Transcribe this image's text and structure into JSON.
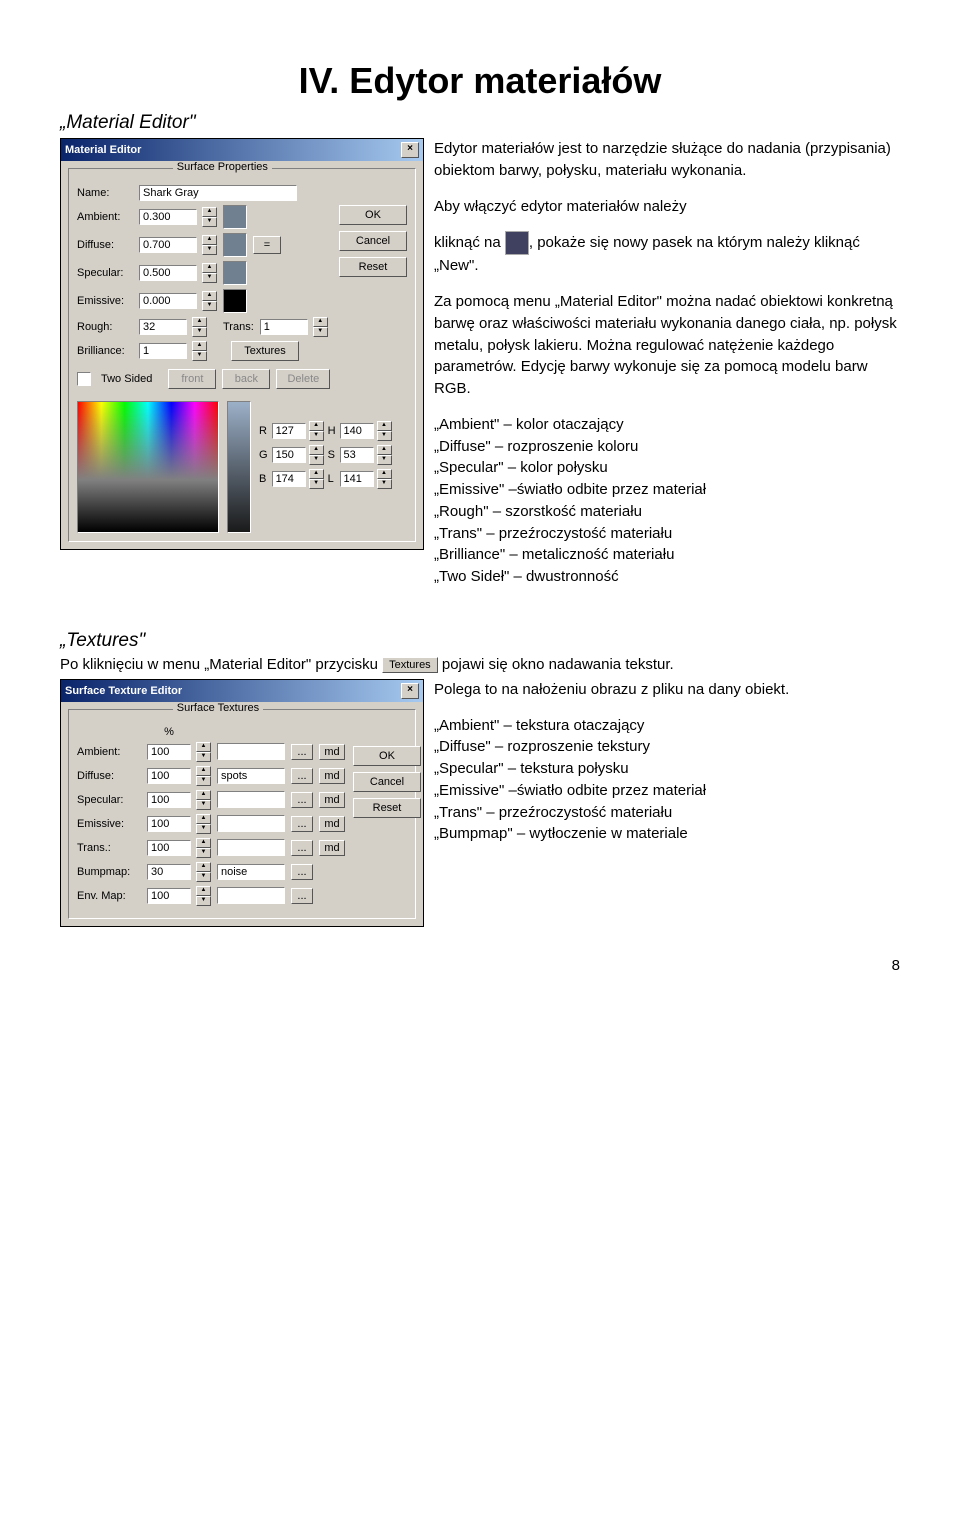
{
  "heading": "IV. Edytor materiałów",
  "sub1": "„Material Editor\"",
  "intro1": "Edytor materiałów jest to narzędzie służące do nadania (przypisania) obiektom barwy, połysku, materiału wykonania.",
  "intro2a": "Aby włączyć edytor materiałów należy",
  "intro2b": "kliknąć na ",
  "intro2c": ", pokaże się nowy pasek na którym należy kliknąć „New\".",
  "intro3": "Za pomocą menu „Material Editor\" można nadać obiektowi konkretną barwę oraz właściwości materiału wykonania danego ciała, np. połysk metalu, połysk lakieru. Można regulować natężenie każdego parametrów. Edycję barwy wykonuje się za pomocą modelu barw RGB.",
  "defs": "„Ambient\" – kolor otaczający\n„Diffuse\" – rozproszenie koloru\n„Specular\" – kolor połysku\n„Emissive\" –światło odbite przez materiał\n„Rough\" – szorstkość materiału\n„Trans\" – przeźroczystość materiału\n„Brilliance\" – metaliczność materiału\n„Two Sideł\" – dwustronność",
  "matEditor": {
    "title": "Material Editor",
    "section": "Surface Properties",
    "nameLbl": "Name:",
    "nameVal": "Shark Gray",
    "ambientLbl": "Ambient:",
    "ambientVal": "0.300",
    "diffuseLbl": "Diffuse:",
    "diffuseVal": "0.700",
    "specularLbl": "Specular:",
    "specularVal": "0.500",
    "emissiveLbl": "Emissive:",
    "emissiveVal": "0.000",
    "roughLbl": "Rough:",
    "roughVal": "32",
    "transLbl": "Trans:",
    "transVal": "1",
    "brillianceLbl": "Brilliance:",
    "brillianceVal": "1",
    "texturesBtn": "Textures",
    "twoSidedLbl": "Two Sided",
    "front": "front",
    "back": "back",
    "delete": "Delete",
    "ok": "OK",
    "cancel": "Cancel",
    "reset": "Reset",
    "eq": "=",
    "R": "R",
    "G": "G",
    "B": "B",
    "H": "H",
    "S": "S",
    "L": "L",
    "Rv": "127",
    "Gv": "150",
    "Bv": "174",
    "Hv": "140",
    "Sv": "53",
    "Lv": "141"
  },
  "sub2": "„Textures\"",
  "tex1a": "Po kliknięciu w menu „Material Editor\" przycisku ",
  "tex1b": " pojawi się okno nadawania tekstur.",
  "tex2": "Polega to na nałożeniu obrazu z pliku na dany obiekt.",
  "texdefs": "„Ambient\" – tekstura otaczający\n„Diffuse\" – rozproszenie tekstury\n„Specular\" – tekstura połysku\n„Emissive\" –światło odbite przez materiał\n„Trans\" – przeźroczystość materiału\n„Bumpmap\" – wytłoczenie w materiale",
  "texEditor": {
    "title": "Surface Texture Editor",
    "section": "Surface Textures",
    "pct": "%",
    "ambientLbl": "Ambient:",
    "ambientVal": "100",
    "ambientT": "",
    "diffuseLbl": "Diffuse:",
    "diffuseVal": "100",
    "diffuseT": "spots",
    "specularLbl": "Specular:",
    "specularVal": "100",
    "specularT": "",
    "emissiveLbl": "Emissive:",
    "emissiveVal": "100",
    "emissiveT": "",
    "transLbl": "Trans.:",
    "transVal": "100",
    "transT": "",
    "bumpLbl": "Bumpmap:",
    "bumpVal": "30",
    "bumpT": "noise",
    "envLbl": "Env. Map:",
    "envVal": "100",
    "envT": "",
    "dots": "...",
    "md": "md",
    "ok": "OK",
    "cancel": "Cancel",
    "reset": "Reset"
  },
  "texturesInline": "Textures",
  "page": "8"
}
